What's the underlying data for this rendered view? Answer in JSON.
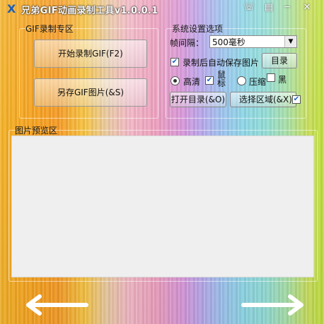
{
  "app": {
    "icon": "X",
    "title": "兄弟GIF动画录制工具v1.0.0.1"
  },
  "titlebar": {
    "chat_icon": "☏",
    "menu_icon": "▤",
    "minimize_icon": "─",
    "close_icon": "✕"
  },
  "gif_group": {
    "legend": "GIF录制专区",
    "start_record_label": "开始录制GIF(F2)",
    "save_as_label": "另存GIF图片(&S)"
  },
  "sys_group": {
    "legend": "系统设置选项",
    "frame_interval_label": "帧间隔：",
    "frame_interval_value": "500毫秒",
    "autosave_label": "录制后自动保存图片",
    "autosave_checked": true,
    "dir_button_label": "目录",
    "hd_label": "高清",
    "hd_selected": true,
    "mouse_label_line1": "鼠",
    "mouse_label_line2": "标",
    "mouse_checked": true,
    "compress_label": "压缩",
    "compress_selected": false,
    "black_label": "黑",
    "black_checked": false,
    "open_dir_label": "打开目录(&O)",
    "select_area_label": "选择区域(&X)",
    "select_area_checked": true
  },
  "preview_group": {
    "legend": "图片预览区"
  },
  "nav": {
    "prev_icon": "left-arrow-icon",
    "next_icon": "right-arrow-icon"
  }
}
